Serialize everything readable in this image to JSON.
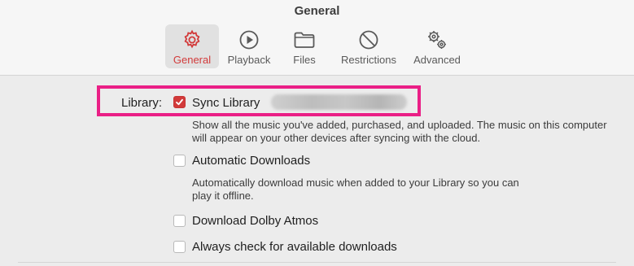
{
  "window": {
    "title": "General"
  },
  "tabs": [
    {
      "label": "General",
      "icon": "gear-icon",
      "selected": true
    },
    {
      "label": "Playback",
      "icon": "play-circle-icon",
      "selected": false
    },
    {
      "label": "Files",
      "icon": "folder-icon",
      "selected": false
    },
    {
      "label": "Restrictions",
      "icon": "prohibited-icon",
      "selected": false
    },
    {
      "label": "Advanced",
      "icon": "gears-icon",
      "selected": false
    }
  ],
  "library": {
    "label": "Library:",
    "sync": {
      "label": "Sync Library",
      "checked": true,
      "account": "",
      "description": "Show all the music you've added, purchased, and uploaded. The music on this computer will appear on your other devices after syncing with the cloud."
    }
  },
  "options": [
    {
      "label": "Automatic Downloads",
      "checked": false,
      "description": "Automatically download music when added to your Library so you can play it offline."
    },
    {
      "label": "Download Dolby Atmos",
      "checked": false
    },
    {
      "label": "Always check for available downloads",
      "checked": false
    }
  ],
  "colors": {
    "accent": "#d23a3a",
    "highlight": "#ea1f86",
    "toolbar_bg": "#f6f6f6",
    "content_bg": "#ececec"
  }
}
